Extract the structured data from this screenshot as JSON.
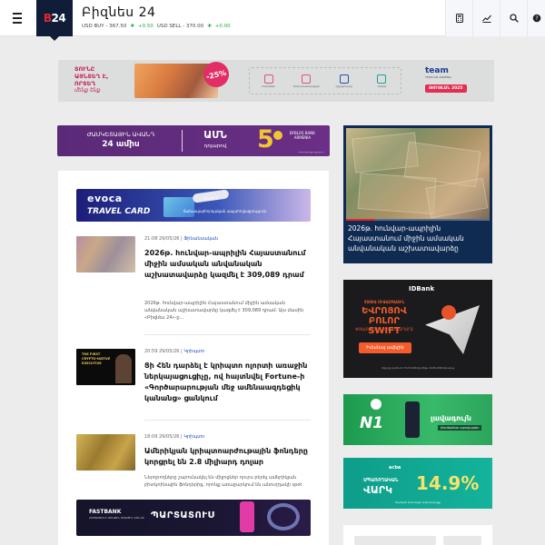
{
  "header": {
    "logo_b": "B",
    "logo_num": "24",
    "site_title": "Բիզնես 24",
    "rates": {
      "buy_label": "USD BUY - 367.50",
      "buy_change": "+0.50",
      "sell_label": "USD SELL - 370.00",
      "sell_change": "+0.00"
    },
    "icons": [
      "calculator-icon",
      "chart-icon",
      "search-icon",
      "globe-icon"
    ]
  },
  "banner_top": {
    "line1": "ՏՈՒՆԸ",
    "line2": "ԱՅՆՏԵՂ Է,",
    "line3": "ՈՐՏԵՂ",
    "line4": "մենք ենք",
    "badge": "-25%",
    "icon_labels": [
      "Ինտերնետ",
      "Հեռուստատեսություն",
      "Բջջային կապ",
      "Սմարթ"
    ],
    "brand": "team",
    "brand_sub": "TELECOM ARMENIA",
    "tag": "ԹՈՒԹԼԱՆ 2025"
  },
  "banner_amd": {
    "line1": "ԺԱՄԿԵՏԱՅԻՆ ԱՎԱՆԴ",
    "line2": "24 ամիս",
    "cur": "ԱՄՆ",
    "cur_sub": "դոլարով",
    "big": "5",
    "bank": "BYBLOS BANK",
    "bank_sub": "ARMENIA",
    "foot": "Տոկոսադրույքը ֆիքսված է"
  },
  "evoca": {
    "brand": "evoca",
    "product": "TRAVEL CARD",
    "promo1": "ԱՆՎՃԱՐ",
    "promo2": "ճանապարհորդական ապահովագրություն"
  },
  "articles": [
    {
      "time": "21:08 29/05/26",
      "category": "Ֆինանսական",
      "title": "2026թ. հունվար-ապրիլին Հայաստանում միջին ամսական անվանական աշխատավարձը կազմել է 309,089 դրամ",
      "excerpt": "2026թ. հունվար-ապրիլին Հայաստանում միջին ամսական անվանական աշխատավարձը կազմել է 309,089 դրամ: Այս մասին «Բիզնես 24»-ը..."
    },
    {
      "time": "20:59 29/05/26",
      "category": "Կրիպտո",
      "thumb_label": "THE FIRST CRYPTO-NATIVE EXECUTIVE",
      "title": "Ցի Հեն դարձել է կրիպտո ոլորտի առաջին ներկայացուցիչը, ով հայտնվել Fortune-ի «Գործարարության մեջ ամենաազդեցիկ կանանց» ցանկում",
      "excerpt": ""
    },
    {
      "time": "18:09 29/05/26",
      "category": "Կրիպտո",
      "title": "Ամերիկյան կրիպտոարժութային ֆոնդերը կորցրել են 2.8 միլիարդ դոլար",
      "excerpt": "Ներդրողները շարունակել են միջոցներ դուրս բերել ամերիկյան բիտկոինային ֆոնդերից, որոնք առաջարկում են անուղղակի spot բիթքոյնով..."
    }
  ],
  "fastbank": {
    "brand": "FASTBANK",
    "sub": "ՀԱՅԱՍՏԱՆԻ ԱՌԱՋԻՆ ԹՎԱՅԻՆ ԲԱՆԿԸ",
    "headline": "ՊԱՐՏԱՏՈՒՍ"
  },
  "slider": {
    "title": "2026թ. հունվար-ապրիլին Հայաստանում միջին ամսական անվանական աշխատավարձը",
    "progress": 0.2
  },
  "idbank": {
    "brand": "IDBank",
    "line1": "5000$ ՄԻՋԱԶԳԱՅԻՆ",
    "line2": "ԵՎՐՈՅՈՎ ԲՈԼՈՐ SWIFT",
    "line3": "ՓՈԽԱՆՑՈՒՄՆԵՐԸ ՀԵՏԱԴԱՐՁ",
    "cta": "Իմանալ ավելին",
    "foot": "Արշավը գործում է 15.03.2026-ից մինչև 30.06.2026 ներառյալ"
  },
  "ucom": {
    "n1": "N1",
    "text": "լավագույն",
    "sub": "ինտերնետ պրովայդեր"
  },
  "acba": {
    "brand": "acba",
    "line1": "ՍՊԱՌՈՂԱԿԱՆ",
    "line2": "ՎԱՐԿ",
    "pct": "14.9%",
    "foot": "Տարեկան փաստացի տոկոսադրույքը"
  }
}
